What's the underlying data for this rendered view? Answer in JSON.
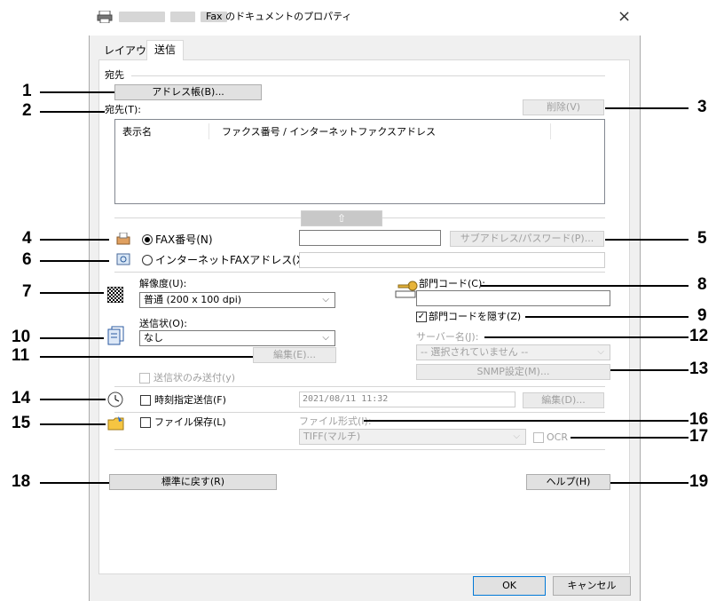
{
  "window": {
    "title": "Fax のドキュメントのプロパティ",
    "close_glyph": "×"
  },
  "tabs": [
    {
      "label": "レイアウト"
    },
    {
      "label": "送信"
    }
  ],
  "destination": {
    "group_label": "宛先",
    "address_book_button": "アドレス帳(B)...",
    "list_label": "宛先(T):",
    "delete_button": "削除(V)",
    "columns": [
      "表示名",
      "ファクス番号 / インターネットファクスアドレス"
    ],
    "add_arrow": "⇧"
  },
  "fax": {
    "fax_number_label": "FAX番号(N)",
    "fax_number_value": "",
    "subaddress_button": "サブアドレス/パスワード(P)...",
    "ifax_label": "インターネットFAXアドレス(X)",
    "ifax_value": ""
  },
  "resolution": {
    "label": "解像度(U):",
    "selected": "普通 (200 x 100 dpi)"
  },
  "dept_code": {
    "label": "部門コード(C):",
    "value": "",
    "hide_label": "部門コードを隠す(Z)",
    "hide_checked": true
  },
  "cover": {
    "label": "送信状(O):",
    "selected": "なし",
    "edit_button": "編集(E)...",
    "only_cover_label": "送信状のみ送付(y)"
  },
  "server": {
    "label": "サーバー名(J):",
    "selected": "-- 選択されていません --",
    "snmp_button": "SNMP設定(M)..."
  },
  "schedule": {
    "label": "時刻指定送信(F)",
    "datetime": "2021/08/11 11:32",
    "edit_button": "編集(D)..."
  },
  "file_save": {
    "label": "ファイル保存(L)",
    "format_label": "ファイル形式(I):",
    "format_selected": "TIFF(マルチ)",
    "ocr_label": "OCR"
  },
  "bottom": {
    "restore_button": "標準に戻す(R)",
    "help_button": "ヘルプ(H)",
    "ok_button": "OK",
    "cancel_button": "キャンセル"
  },
  "callouts": [
    "1",
    "2",
    "3",
    "4",
    "5",
    "6",
    "7",
    "8",
    "9",
    "10",
    "11",
    "12",
    "13",
    "14",
    "15",
    "16",
    "17",
    "18",
    "19"
  ]
}
